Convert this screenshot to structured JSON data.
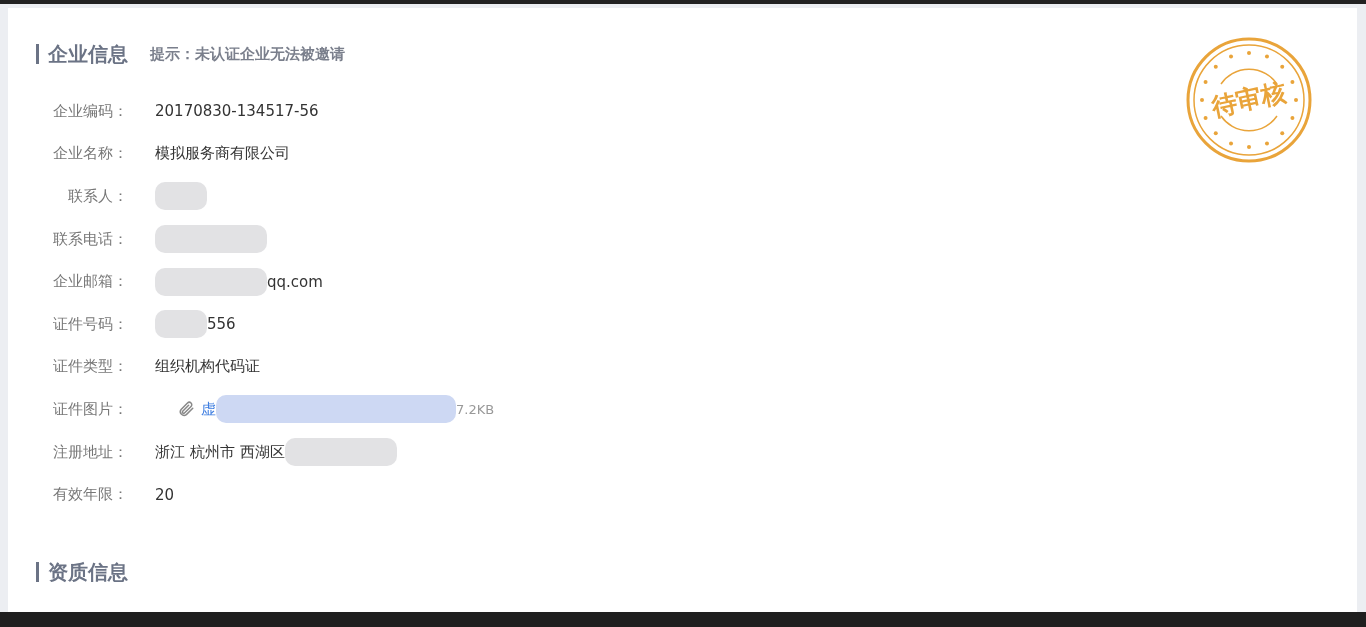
{
  "sections": [
    {
      "title": "企业信息",
      "hint": "提示：未认证企业无法被邀请",
      "stamp": "待审核",
      "rows": [
        {
          "label": "企业编码：",
          "parts": [
            {
              "kind": "text",
              "text": "20170830-134517-56"
            }
          ]
        },
        {
          "label": "企业名称：",
          "parts": [
            {
              "kind": "text",
              "text": "模拟服务商有限公司"
            }
          ]
        },
        {
          "label": "联系人：",
          "parts": [
            {
              "kind": "blurstub"
            }
          ]
        },
        {
          "label": "联系电话：",
          "parts": [
            {
              "kind": "blur"
            }
          ]
        },
        {
          "label": "企业邮箱：",
          "parts": [
            {
              "kind": "blur"
            },
            {
              "kind": "text",
              "text": "qq.com"
            }
          ]
        },
        {
          "label": "证件号码：",
          "parts": [
            {
              "kind": "blurstub"
            },
            {
              "kind": "text",
              "text": "556"
            }
          ]
        },
        {
          "label": "证件类型：",
          "parts": [
            {
              "kind": "text",
              "text": "组织机构代码证"
            }
          ]
        },
        {
          "label": "证件图片：",
          "parts": [
            {
              "kind": "clip"
            },
            {
              "kind": "link",
              "text": "虚"
            },
            {
              "kind": "blurlink"
            },
            {
              "kind": "size",
              "text": "7.2KB"
            }
          ]
        },
        {
          "label": "注册地址：",
          "parts": [
            {
              "kind": "text",
              "text": "浙江 杭州市 西湖区"
            },
            {
              "kind": "blur"
            }
          ]
        },
        {
          "label": "有效年限：",
          "parts": [
            {
              "kind": "text",
              "text": "20"
            }
          ]
        }
      ]
    },
    {
      "title": "资质信息"
    }
  ]
}
